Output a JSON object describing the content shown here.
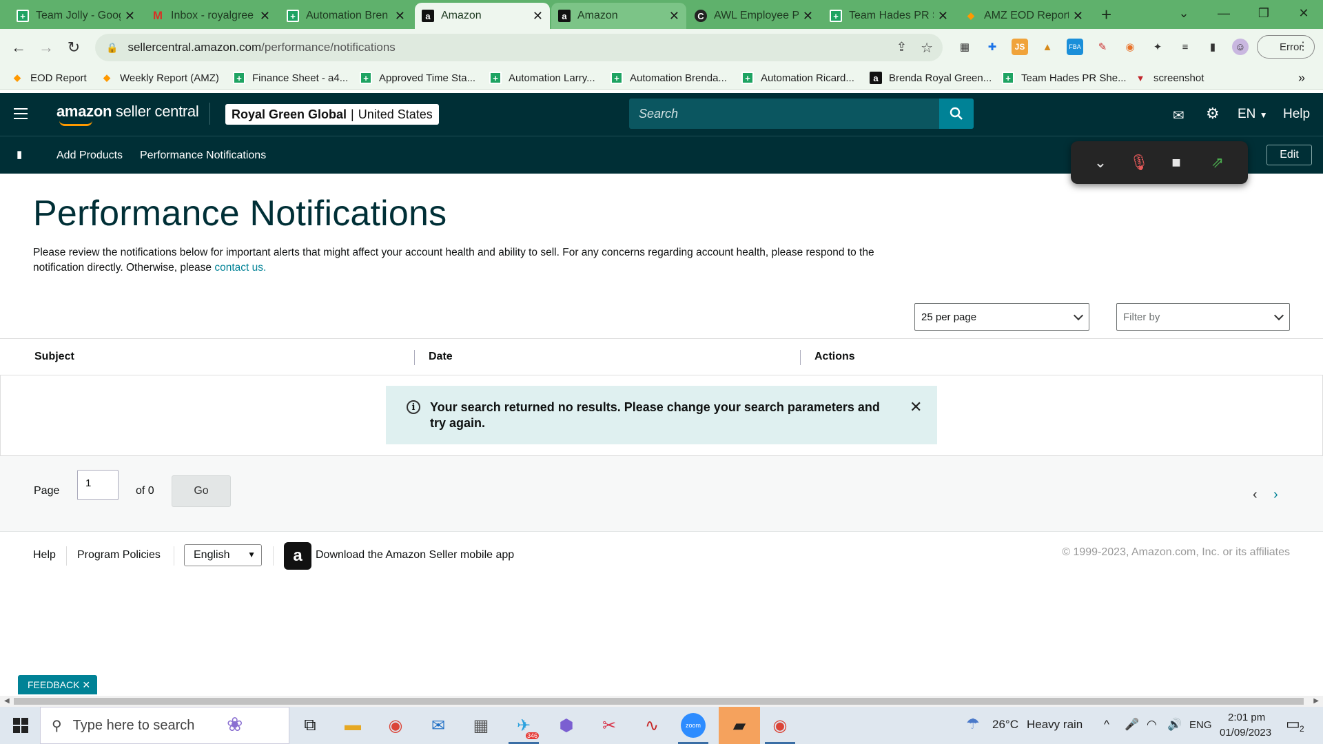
{
  "browser": {
    "tabs": [
      {
        "title": "Team Jolly - Goog",
        "icon": "sheets-icon"
      },
      {
        "title": "Inbox - royalgree",
        "icon": "gmail-icon"
      },
      {
        "title": "Automation Bren",
        "icon": "sheets-icon"
      },
      {
        "title": "Amazon",
        "icon": "amazon-icon"
      },
      {
        "title": "Amazon",
        "icon": "amazon-icon"
      },
      {
        "title": "AWL Employee Po",
        "icon": "awl-icon"
      },
      {
        "title": "Team Hades PR Sh",
        "icon": "sheets-icon"
      },
      {
        "title": "AMZ EOD Report",
        "icon": "report-icon"
      }
    ],
    "new_tab": "+",
    "url_host": "sellercentral.amazon.com",
    "url_path": "/performance/notifications",
    "profile_status": "Error",
    "bookmarks": [
      {
        "label": "EOD Report",
        "icon": "report-icon"
      },
      {
        "label": "Weekly Report (AMZ)",
        "icon": "report-icon"
      },
      {
        "label": "Finance Sheet - a4...",
        "icon": "sheets-icon"
      },
      {
        "label": "Approved Time Sta...",
        "icon": "sheets-icon"
      },
      {
        "label": "Automation Larry...",
        "icon": "sheets-icon"
      },
      {
        "label": "Automation Brenda...",
        "icon": "sheets-icon"
      },
      {
        "label": "Automation Ricard...",
        "icon": "sheets-icon"
      },
      {
        "label": "Brenda Royal Green...",
        "icon": "amazon-icon"
      },
      {
        "label": "Team Hades PR She...",
        "icon": "sheets-icon"
      },
      {
        "label": "screenshot",
        "icon": "screenshot-icon"
      }
    ],
    "bookmarks_more": "»"
  },
  "seller_central": {
    "logo_main": "amazon",
    "logo_sub": "seller central",
    "account_name": "Royal Green Global",
    "account_region": "United States",
    "search_placeholder": "Search",
    "language": "EN",
    "help": "Help",
    "subnav": [
      "Add Products",
      "Performance Notifications"
    ],
    "edit": "Edit"
  },
  "page": {
    "title": "Performance Notifications",
    "description": "Please review the notifications below for important alerts that might affect your account health and ability to sell. For any concerns regarding account health, please respond to the notification directly. Otherwise, please",
    "contact_link": "contact us.",
    "per_page": "25 per page",
    "filter_placeholder": "Filter by",
    "columns": [
      "Subject",
      "Date",
      "Actions"
    ],
    "alert_message": "Your search returned no results. Please change your search parameters and try again.",
    "pager": {
      "label": "Page",
      "current": "1",
      "of_text": "of 0",
      "go": "Go"
    }
  },
  "footer": {
    "help": "Help",
    "program_policies": "Program Policies",
    "language": "English",
    "app_download": "Download the Amazon Seller mobile app",
    "copyright": "© 1999-2023, Amazon.com, Inc. or its affiliates"
  },
  "feedback": "FEEDBACK ✕",
  "taskbar": {
    "search_placeholder": "Type here to search",
    "telegram_badge": "346",
    "weather_temp": "26°C",
    "weather_desc": "Heavy rain",
    "lang": "ENG",
    "time": "2:01 pm",
    "date": "01/09/2023",
    "notifications": "2"
  }
}
